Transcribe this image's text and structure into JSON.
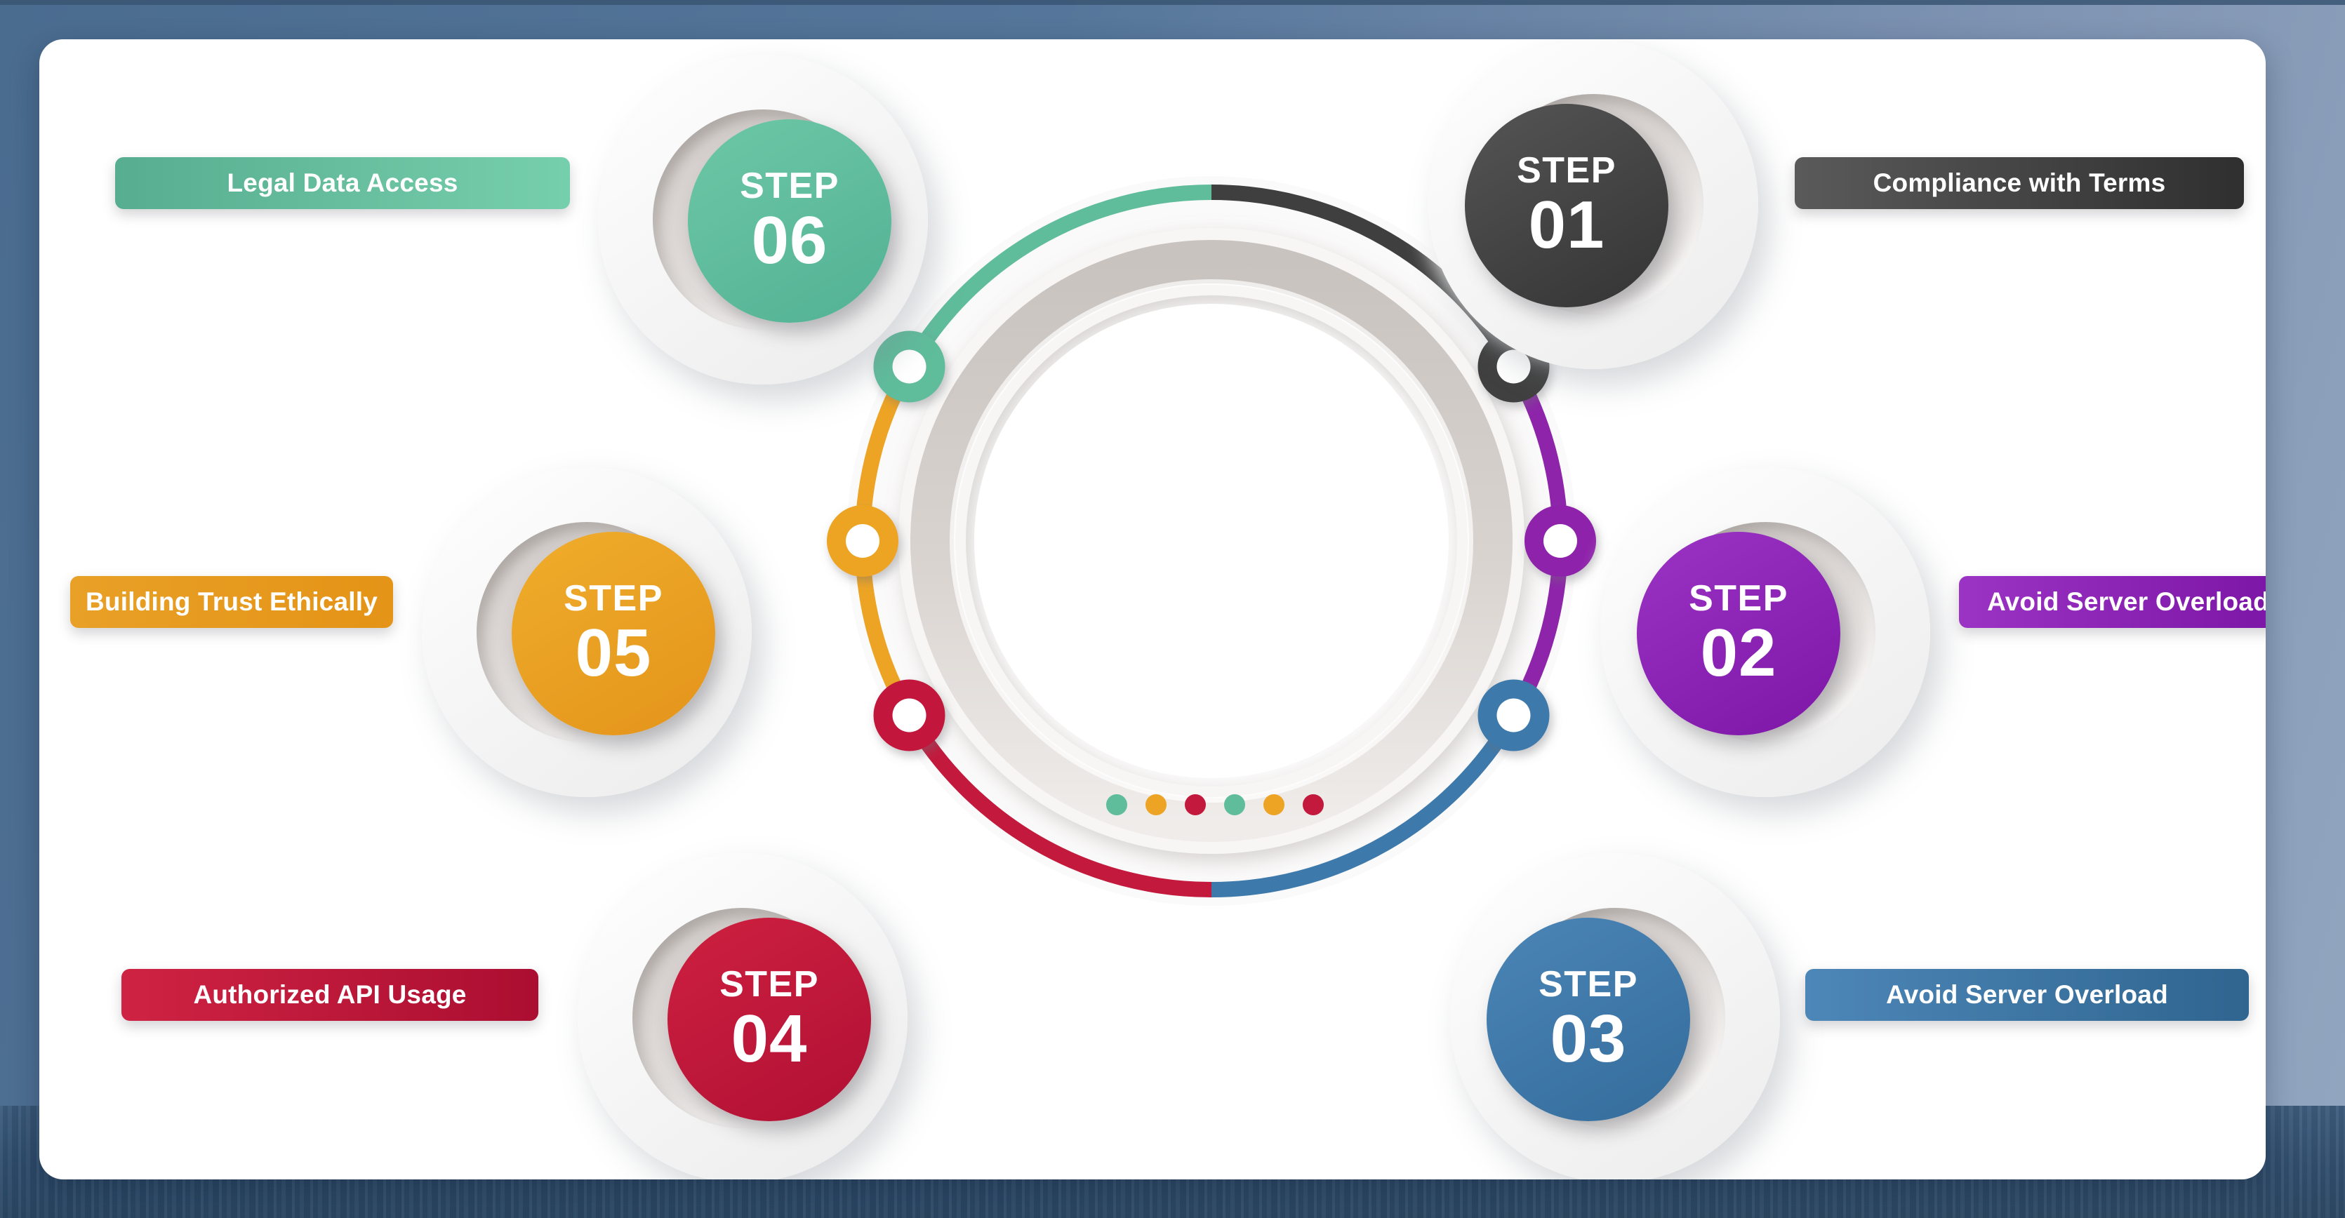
{
  "canvas": {
    "background_color": "#55769a",
    "card_color": "#ffffff"
  },
  "palette": {
    "step01": "#3f3f3f",
    "step02": "#8e24aa",
    "step03": "#3d79ab",
    "step04": "#c2193c",
    "step05": "#eda424",
    "step06": "#5fbd9c",
    "ring_track": "#d7d1ce"
  },
  "steps": [
    {
      "id": "step01",
      "step_word": "STEP",
      "number": "01",
      "label": "Compliance with Terms",
      "color_start": "#555555",
      "color_end": "#343434",
      "label_color_start": "#5a5a5a",
      "label_color_end": "#2f2f2f",
      "side": "right"
    },
    {
      "id": "step02",
      "step_word": "STEP",
      "number": "02",
      "label": "Avoid Server Overload",
      "color_start": "#9b33c4",
      "color_end": "#7d16a7",
      "label_color_start": "#9b33c4",
      "label_color_end": "#7a14a4",
      "side": "right"
    },
    {
      "id": "step03",
      "step_word": "STEP",
      "number": "03",
      "label": "Avoid Server Overload",
      "color_start": "#4b85b6",
      "color_end": "#346d9c",
      "label_color_start": "#4d87b8",
      "label_color_end": "#2f658f",
      "side": "right"
    },
    {
      "id": "step04",
      "step_word": "STEP",
      "number": "04",
      "label": "Authorized API Usage",
      "color_start": "#ce2040",
      "color_end": "#b01034",
      "label_color_start": "#cf2343",
      "label_color_end": "#ab0e31",
      "side": "left"
    },
    {
      "id": "step05",
      "step_word": "STEP",
      "number": "05",
      "label": "Building Trust Ethically",
      "color_start": "#f0ad2c",
      "color_end": "#e3941a",
      "label_color_start": "#e8a026",
      "label_color_end": "#e49417",
      "side": "left"
    },
    {
      "id": "step06",
      "step_word": "STEP",
      "number": "06",
      "label": "Legal Data Access",
      "color_start": "#6cc7a6",
      "color_end": "#53b294",
      "label_color_start": "#57ad90",
      "label_color_end": "#76cfac",
      "side": "left"
    }
  ],
  "center_dots": [
    {
      "color": "#5fbd9c"
    },
    {
      "color": "#eda424"
    },
    {
      "color": "#c2193c"
    },
    {
      "color": "#5fbd9c"
    },
    {
      "color": "#eda424"
    },
    {
      "color": "#c2193c"
    }
  ],
  "chart_data": {
    "type": "pie",
    "title": "",
    "categories": [
      "STEP 01",
      "STEP 02",
      "STEP 03",
      "STEP 04",
      "STEP 05",
      "STEP 06"
    ],
    "values": [
      60,
      60,
      60,
      60,
      60,
      60
    ],
    "labels": [
      "Compliance with Terms",
      "Avoid Server Overload",
      "Avoid Server Overload",
      "Authorized API Usage",
      "Building Trust Ethically",
      "Legal Data Access"
    ],
    "colors": [
      "#3f3f3f",
      "#8e24aa",
      "#3d79ab",
      "#c2193c",
      "#eda424",
      "#5fbd9c"
    ],
    "legend": "none",
    "grid": false
  }
}
